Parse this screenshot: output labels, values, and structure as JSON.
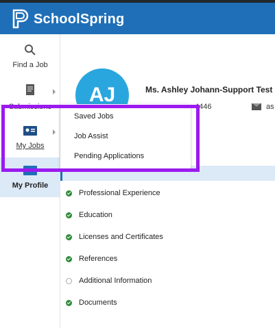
{
  "header": {
    "brand": "SchoolSpring"
  },
  "sidebar": {
    "items": [
      {
        "label": "Find a Job",
        "icon": "search-icon"
      },
      {
        "label": "Submissions",
        "icon": "document-icon"
      },
      {
        "label": "My Jobs",
        "icon": "id-card-icon"
      },
      {
        "label": "My Profile",
        "icon": "profile-icon"
      }
    ]
  },
  "dropdown": {
    "items": [
      "Saved Jobs",
      "Job Assist",
      "Pending Applications"
    ]
  },
  "profile": {
    "initials": "AJ",
    "name": "Ms. Ashley Johann-Support Test",
    "phone_fragment": "4446",
    "email_fragment": "as"
  },
  "sections": [
    {
      "label": "Professional Experience",
      "status": "complete"
    },
    {
      "label": "Education",
      "status": "complete"
    },
    {
      "label": "Licenses and Certificates",
      "status": "complete"
    },
    {
      "label": "References",
      "status": "complete"
    },
    {
      "label": "Additional Information",
      "status": "incomplete"
    },
    {
      "label": "Documents",
      "status": "complete"
    }
  ],
  "colors": {
    "brand": "#1f6fb8",
    "avatar": "#2aa6de",
    "highlight": "#9b1aef",
    "check": "#2e8b3a"
  }
}
